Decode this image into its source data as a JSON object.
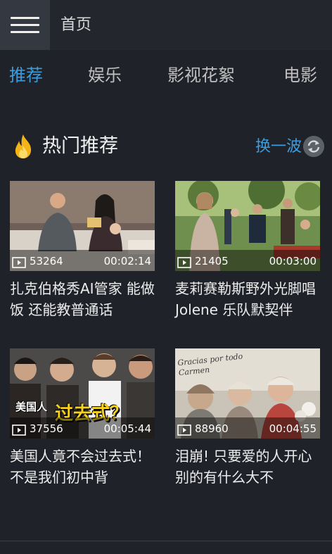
{
  "header": {
    "title": "首页"
  },
  "tabs": [
    {
      "label": "推荐",
      "active": true
    },
    {
      "label": "娱乐",
      "active": false
    },
    {
      "label": "影视花絮",
      "active": false
    },
    {
      "label": "电影",
      "active": false
    }
  ],
  "section": {
    "title": "热门推荐",
    "refresh_label": "换一波",
    "icon": "fire-icon"
  },
  "videos": [
    {
      "views": "53264",
      "duration": "00:02:14",
      "title": "扎克伯格秀AI管家 能做饭 还能教普通话"
    },
    {
      "views": "21405",
      "duration": "00:03:00",
      "title": "麦莉赛勒斯野外光脚唱Jolene 乐队默契伴"
    },
    {
      "views": "37556",
      "duration": "00:05:44",
      "title": "美国人竟不会过去式！不是我们初中背",
      "thumb_text_1": "美国人",
      "thumb_text_2": "过去式？"
    },
    {
      "views": "88960",
      "duration": "00:04:55",
      "title": "泪崩! 只要爱的人开心 别的有什么大不",
      "thumb_text_1": "Gracias por todo Carmen"
    }
  ],
  "colors": {
    "accent": "#3b9de0",
    "background": "#1f2329",
    "topbar": "#23272d"
  }
}
